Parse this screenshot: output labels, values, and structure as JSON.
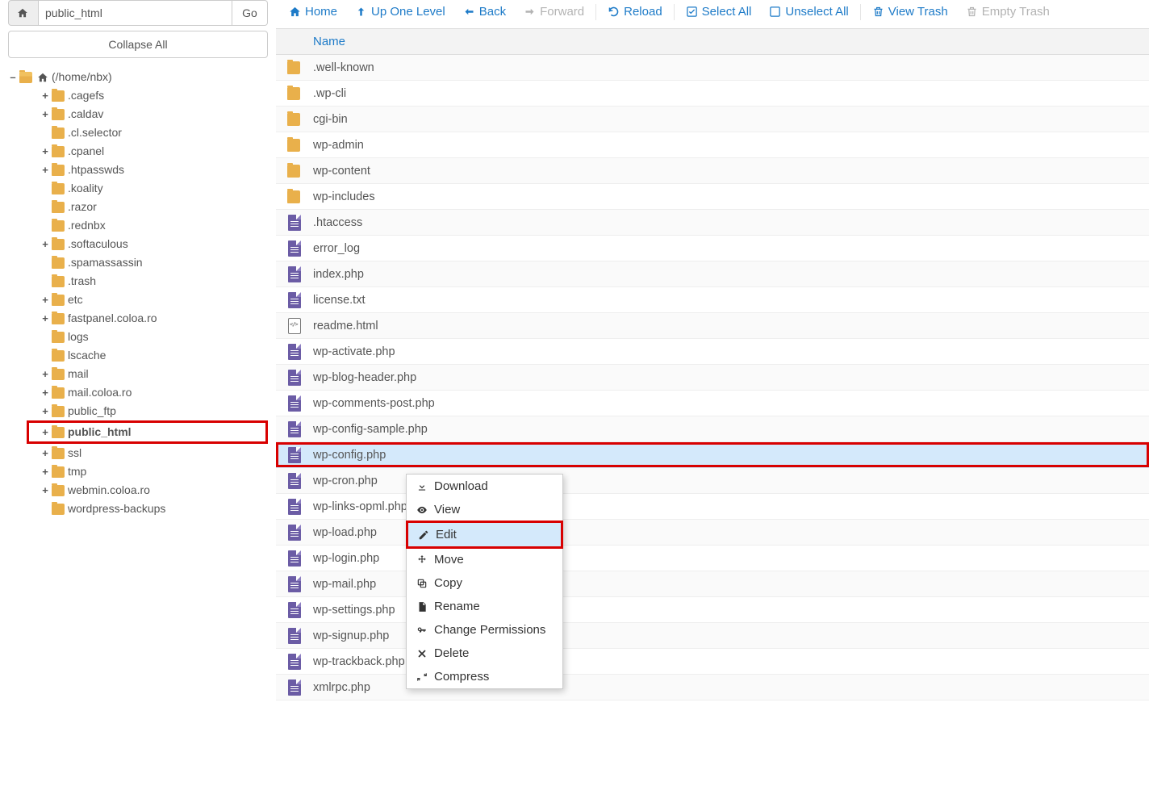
{
  "sidebar": {
    "path_value": "public_html",
    "go_label": "Go",
    "collapse_label": "Collapse All",
    "root_label": "(/home/nbx)",
    "items": [
      {
        "toggle": "+",
        "label": ".cagefs"
      },
      {
        "toggle": "+",
        "label": ".caldav"
      },
      {
        "toggle": "",
        "label": ".cl.selector"
      },
      {
        "toggle": "+",
        "label": ".cpanel"
      },
      {
        "toggle": "+",
        "label": ".htpasswds"
      },
      {
        "toggle": "",
        "label": ".koality"
      },
      {
        "toggle": "",
        "label": ".razor"
      },
      {
        "toggle": "",
        "label": ".rednbx"
      },
      {
        "toggle": "+",
        "label": ".softaculous"
      },
      {
        "toggle": "",
        "label": ".spamassassin"
      },
      {
        "toggle": "",
        "label": ".trash"
      },
      {
        "toggle": "+",
        "label": "etc"
      },
      {
        "toggle": "+",
        "label": "fastpanel.coloa.ro"
      },
      {
        "toggle": "",
        "label": "logs"
      },
      {
        "toggle": "",
        "label": "lscache"
      },
      {
        "toggle": "+",
        "label": "mail"
      },
      {
        "toggle": "+",
        "label": "mail.coloa.ro"
      },
      {
        "toggle": "+",
        "label": "public_ftp"
      },
      {
        "toggle": "+",
        "label": "public_html",
        "highlight": true,
        "bold": true
      },
      {
        "toggle": "+",
        "label": "ssl"
      },
      {
        "toggle": "+",
        "label": "tmp"
      },
      {
        "toggle": "+",
        "label": "webmin.coloa.ro"
      },
      {
        "toggle": "",
        "label": "wordpress-backups"
      }
    ]
  },
  "toolbar": {
    "home": "Home",
    "up": "Up One Level",
    "back": "Back",
    "forward": "Forward",
    "reload": "Reload",
    "select_all": "Select All",
    "unselect_all": "Unselect All",
    "view_trash": "View Trash",
    "empty_trash": "Empty Trash"
  },
  "table": {
    "header_name": "Name",
    "rows": [
      {
        "type": "folder",
        "name": ".well-known"
      },
      {
        "type": "folder",
        "name": ".wp-cli"
      },
      {
        "type": "folder",
        "name": "cgi-bin"
      },
      {
        "type": "folder",
        "name": "wp-admin"
      },
      {
        "type": "folder",
        "name": "wp-content"
      },
      {
        "type": "folder",
        "name": "wp-includes"
      },
      {
        "type": "file",
        "name": ".htaccess"
      },
      {
        "type": "file",
        "name": "error_log"
      },
      {
        "type": "file",
        "name": "index.php"
      },
      {
        "type": "file",
        "name": "license.txt"
      },
      {
        "type": "html",
        "name": "readme.html"
      },
      {
        "type": "file",
        "name": "wp-activate.php"
      },
      {
        "type": "file",
        "name": "wp-blog-header.php"
      },
      {
        "type": "file",
        "name": "wp-comments-post.php"
      },
      {
        "type": "file",
        "name": "wp-config-sample.php"
      },
      {
        "type": "file",
        "name": "wp-config.php",
        "selected": true,
        "red": true
      },
      {
        "type": "file",
        "name": "wp-cron.php"
      },
      {
        "type": "file",
        "name": "wp-links-opml.php"
      },
      {
        "type": "file",
        "name": "wp-load.php"
      },
      {
        "type": "file",
        "name": "wp-login.php"
      },
      {
        "type": "file",
        "name": "wp-mail.php"
      },
      {
        "type": "file",
        "name": "wp-settings.php"
      },
      {
        "type": "file",
        "name": "wp-signup.php"
      },
      {
        "type": "file",
        "name": "wp-trackback.php"
      },
      {
        "type": "file",
        "name": "xmlrpc.php"
      }
    ]
  },
  "context_menu": {
    "download": "Download",
    "view": "View",
    "edit": "Edit",
    "move": "Move",
    "copy": "Copy",
    "rename": "Rename",
    "perms": "Change Permissions",
    "delete": "Delete",
    "compress": "Compress"
  }
}
